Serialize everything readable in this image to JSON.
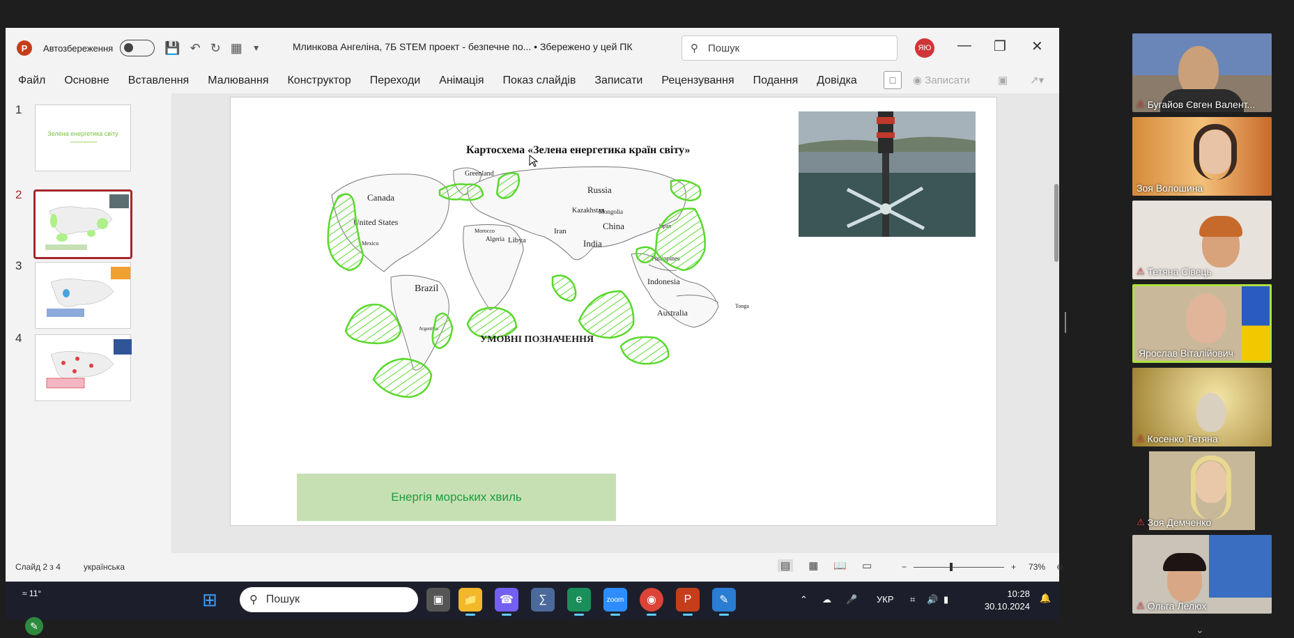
{
  "titlebar": {
    "autosave_label": "Автозбереження",
    "document_title": "Млинкова Ангеліна, 7Б STEM проект  -  безпечне по...   • Збережено у цей ПК",
    "search_placeholder": "Пошук",
    "user_initials": "ЯЮ"
  },
  "menu": {
    "items": [
      "Файл",
      "Основне",
      "Вставлення",
      "Малювання",
      "Конструктор",
      "Переходи",
      "Анімація",
      "Показ слайдів",
      "Записати",
      "Рецензування",
      "Подання",
      "Довідка"
    ],
    "record_label": "Записати"
  },
  "thumbnails": {
    "numbers": [
      "1",
      "2",
      "3",
      "4"
    ],
    "slide1_title": "Зелена енергетика світу",
    "selected_index": 2
  },
  "slide": {
    "map_title": "Картосхема «Зелена енергетика країн світу»",
    "legend_title": "УМОВНІ ПОЗНАЧЕННЯ",
    "legend_item": "Енергія морських хвиль",
    "map_labels": {
      "greenland": "Greenland",
      "canada": "Canada",
      "us": "United States",
      "mexico": "Mexico",
      "brazil": "Brazil",
      "russia": "Russia",
      "kazakhstan": "Kazakhstan",
      "mongolia": "Mongolia",
      "china": "China",
      "japan": "Japan",
      "iran": "Iran",
      "india": "India",
      "libya": "Libya",
      "algeria": "Algeria",
      "morocco": "Morocco",
      "indonesia": "Indonesia",
      "australia": "Australia",
      "philippines": "Philippines",
      "argentina": "Argentina",
      "tonga": "Tonga"
    },
    "accent_color": "#5ad82c"
  },
  "status": {
    "slide_info": "Слайд 2 з 4",
    "language": "українська",
    "zoom": "73%"
  },
  "taskbar": {
    "weather": "11°",
    "search_placeholder": "Пошук",
    "lang": "УКР",
    "time": "10:28",
    "date": "30.10.2024"
  },
  "participants": [
    {
      "name": "Бугайов Євген Валент...",
      "muted": true
    },
    {
      "name": "Зоя Волошина",
      "muted": false
    },
    {
      "name": "Тетяна Сівець",
      "muted": true
    },
    {
      "name": "Ярослав Віталійович",
      "muted": false,
      "speaking": true
    },
    {
      "name": "Косенко Тетяна",
      "muted": true
    },
    {
      "name": "Зоя Демченко",
      "muted": true
    },
    {
      "name": "Ольга Лелюх",
      "muted": true
    }
  ]
}
